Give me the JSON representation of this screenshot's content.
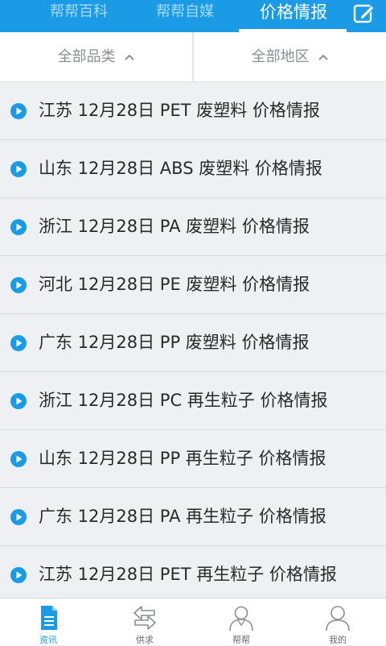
{
  "header": {
    "tabs": [
      {
        "label": "帮帮百科"
      },
      {
        "label": "帮帮自媒"
      },
      {
        "label": "价格情报"
      }
    ],
    "active_tab": "价格情报",
    "edit_icon": "edit-icon"
  },
  "filters": {
    "category": "全部品类",
    "region": "全部地区"
  },
  "list": [
    {
      "text": "江苏 12月28日 PET 废塑料 价格情报"
    },
    {
      "text": "山东 12月28日 ABS 废塑料 价格情报"
    },
    {
      "text": "浙江 12月28日 PA 废塑料 价格情报"
    },
    {
      "text": "河北 12月28日 PE 废塑料 价格情报"
    },
    {
      "text": "广东 12月28日 PP 废塑料 价格情报"
    },
    {
      "text": "浙江 12月28日 PC 再生粒子 价格情报"
    },
    {
      "text": "山东 12月28日 PP 再生粒子 价格情报"
    },
    {
      "text": "广东 12月28日 PA 再生粒子 价格情报"
    },
    {
      "text": "江苏 12月28日 PET 再生粒子 价格情报"
    }
  ],
  "bottom_nav": [
    {
      "label": "资讯",
      "icon": "document-icon",
      "active": true
    },
    {
      "label": "供求",
      "icon": "exchange-icon"
    },
    {
      "label": "帮帮",
      "icon": "user-icon"
    },
    {
      "label": "我的",
      "icon": "person-icon"
    }
  ],
  "colors": {
    "brand_blue": "#1b9be6",
    "list_background": "#eef0f3",
    "text": "#2a2a2a"
  }
}
